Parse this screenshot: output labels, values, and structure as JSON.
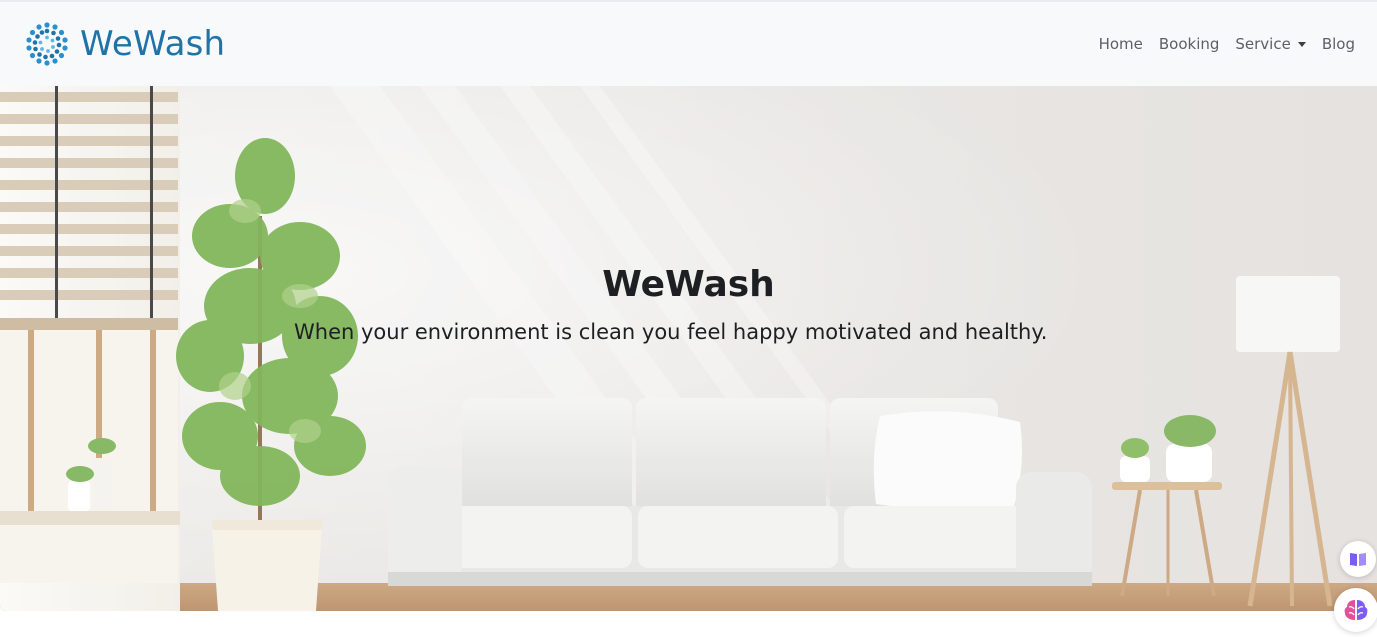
{
  "brand": {
    "name": "WeWash",
    "logo_icon": "sun-burst-logo-icon",
    "color": "#1f73a9"
  },
  "nav": {
    "items": [
      {
        "label": "Home",
        "dropdown": false
      },
      {
        "label": "Booking",
        "dropdown": false
      },
      {
        "label": "Service",
        "dropdown": true
      },
      {
        "label": "Blog",
        "dropdown": false
      }
    ]
  },
  "hero": {
    "title": "WeWash",
    "subtitle": "When your environment is clean you feel happy motivated and healthy.",
    "background": "living-room-photo-white-sofa-plant-lamp"
  },
  "floating": {
    "reader_icon": "book-reader-icon",
    "assistant_icon": "brain-assistant-icon"
  },
  "colors": {
    "navbar_bg": "#f8f9fb",
    "nav_text": "#5b5f66",
    "hero_text": "#1d1f22"
  }
}
